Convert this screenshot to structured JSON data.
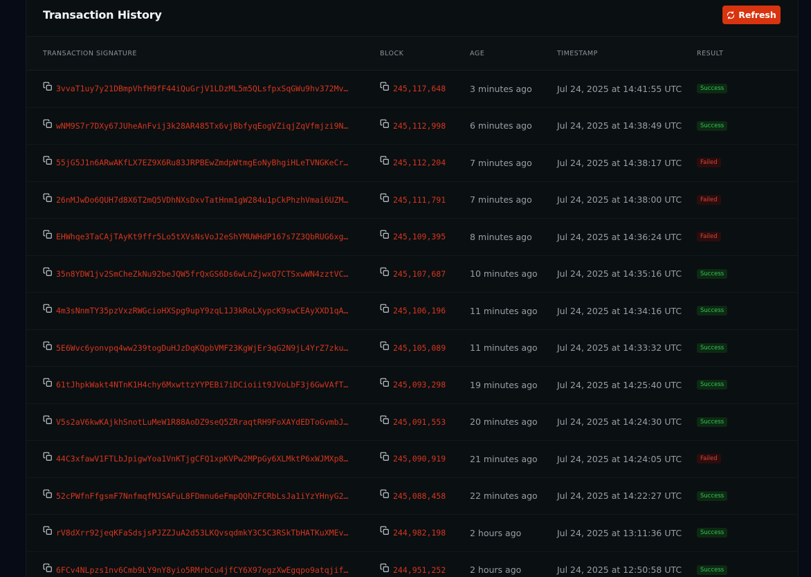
{
  "header": {
    "title": "Transaction History",
    "refresh_label": "Refresh"
  },
  "table": {
    "columns": [
      "TRANSACTION SIGNATURE",
      "BLOCK",
      "AGE",
      "TIMESTAMP",
      "RESULT"
    ],
    "rows": [
      {
        "signature": "3vvaT1uy7y21DBmpVhfH9fF44iQuGrjV1LDzML5m5QLsfpxSqGWu9hv372Mv…",
        "block": "245,117,648",
        "age": "3 minutes ago",
        "timestamp": "Jul 24, 2025 at 14:41:55 UTC",
        "result": "Success"
      },
      {
        "signature": "wNM9S7r7DXy67JUheAnFvij3k28AR485Tx6vjBbfyqEogVZiqjZqVfmjzi9N…",
        "block": "245,112,998",
        "age": "6 minutes ago",
        "timestamp": "Jul 24, 2025 at 14:38:49 UTC",
        "result": "Success"
      },
      {
        "signature": "55jG5J1n6ARwAKfLX7EZ9X6Ru83JRPBEwZmdpWtmgEoNyBhgiHLeTVNGKeCr…",
        "block": "245,112,204",
        "age": "7 minutes ago",
        "timestamp": "Jul 24, 2025 at 14:38:17 UTC",
        "result": "Failed"
      },
      {
        "signature": "26nMJwDo6QUH7d8X6T2mQ5VDhNXsDxvTatHnm1gW284u1pCkPhzhVmai6UZM…",
        "block": "245,111,791",
        "age": "7 minutes ago",
        "timestamp": "Jul 24, 2025 at 14:38:00 UTC",
        "result": "Failed"
      },
      {
        "signature": "EHWhqe3TaCAjTAyKt9ffr5Lo5tXVsNsVoJ2eShYMUWHdP167s7Z3QbRUG6xg…",
        "block": "245,109,395",
        "age": "8 minutes ago",
        "timestamp": "Jul 24, 2025 at 14:36:24 UTC",
        "result": "Failed"
      },
      {
        "signature": "35n8YDW1jv2SmCheZkNu92beJQW5frQxGS6Ds6wLnZjwxQ7CTSxwWN4zztVC…",
        "block": "245,107,687",
        "age": "10 minutes ago",
        "timestamp": "Jul 24, 2025 at 14:35:16 UTC",
        "result": "Success"
      },
      {
        "signature": "4m3sNnmTY35pzVxzRWGcioHXSpg9upY9zqL1J3kRoLXypcK9swCEAyXXD1qA…",
        "block": "245,106,196",
        "age": "11 minutes ago",
        "timestamp": "Jul 24, 2025 at 14:34:16 UTC",
        "result": "Success"
      },
      {
        "signature": "5E6Wvc6yonvpq4ww239togDuHJzDqKQpbVMF23KgWjEr3qG2N9jL4YrZ7zku…",
        "block": "245,105,089",
        "age": "11 minutes ago",
        "timestamp": "Jul 24, 2025 at 14:33:32 UTC",
        "result": "Success"
      },
      {
        "signature": "61tJhpkWakt4NTnK1H4chy6MxwttzYYPEBi7iDCioiit9JVoLbF3j6GwVAfT…",
        "block": "245,093,298",
        "age": "19 minutes ago",
        "timestamp": "Jul 24, 2025 at 14:25:40 UTC",
        "result": "Success"
      },
      {
        "signature": "V5s2aV6kwKAjkhSnotLuMeW1R88AoDZ9seQ5ZRraqtRH9FoXAYdEDToGvmbJ…",
        "block": "245,091,553",
        "age": "20 minutes ago",
        "timestamp": "Jul 24, 2025 at 14:24:30 UTC",
        "result": "Success"
      },
      {
        "signature": "44C3xfawV1FTLbJpigwYoa1VnKTjgCFQ1xpKVPw2MPpGy6XLMktP6xWJMXp8…",
        "block": "245,090,919",
        "age": "21 minutes ago",
        "timestamp": "Jul 24, 2025 at 14:24:05 UTC",
        "result": "Failed"
      },
      {
        "signature": "52cPWfnFfgsmF7NnfmqfMJSAFuL8FDmnu6eFmpQQhZFCRbLsJa1iYzYHnyG2…",
        "block": "245,088,458",
        "age": "22 minutes ago",
        "timestamp": "Jul 24, 2025 at 14:22:27 UTC",
        "result": "Success"
      },
      {
        "signature": "rV8dXrr92jeqKFaSdsjsPJZZJuA2d53LKQvsqdmkY3C5C3RSkTbHATKuXMEv…",
        "block": "244,982,198",
        "age": "2 hours ago",
        "timestamp": "Jul 24, 2025 at 13:11:36 UTC",
        "result": "Success"
      },
      {
        "signature": "6FCv4NLpzs1nv6Cmb9LY9nY8yio5RMrbCu4jfCY6X97ogzXwEgqpo9atqjif…",
        "block": "244,951,252",
        "age": "2 hours ago",
        "timestamp": "Jul 24, 2025 at 12:50:58 UTC",
        "result": "Success"
      }
    ]
  },
  "colors": {
    "accent": "#d8340f",
    "link": "#d7361c",
    "success": "#36c25a",
    "failed": "#d8463c"
  },
  "icons": {
    "refresh": "refresh-icon",
    "copy": "copy-icon"
  }
}
